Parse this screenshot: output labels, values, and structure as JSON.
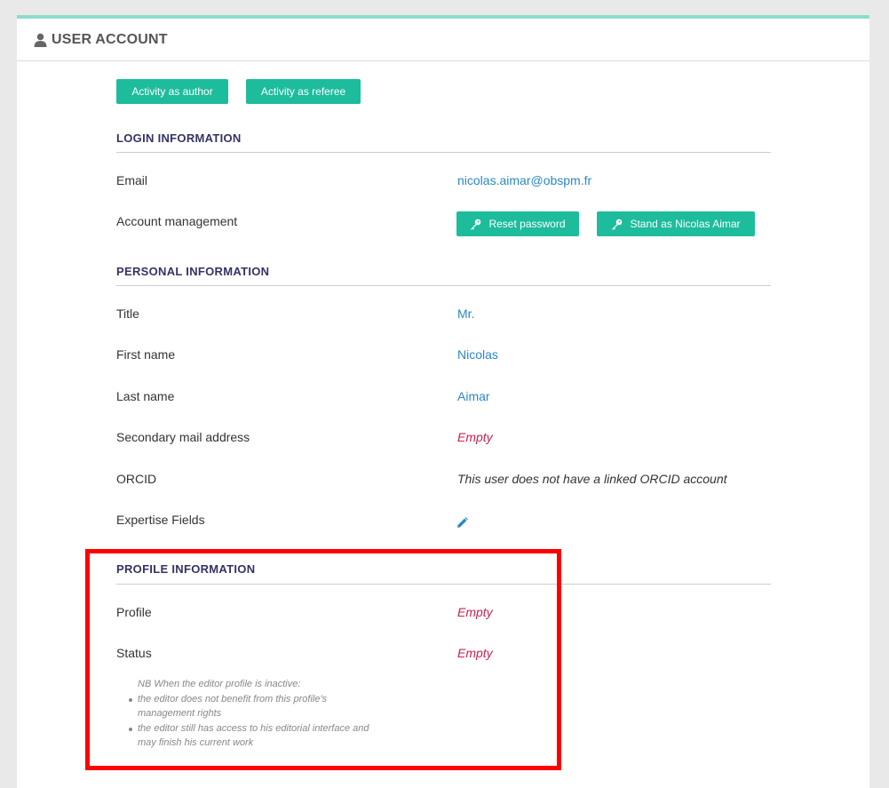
{
  "header": {
    "title": "USER ACCOUNT",
    "icon": "user-icon"
  },
  "actions": {
    "author_label": "Activity as author",
    "referee_label": "Activity as referee"
  },
  "login": {
    "title": "LOGIN INFORMATION",
    "email_label": "Email",
    "email_value": "nicolas.aimar@obspm.fr",
    "account_label": "Account management",
    "reset_label": "Reset password",
    "stand_label": "Stand as Nicolas Aimar"
  },
  "personal": {
    "title": "PERSONAL INFORMATION",
    "title_label": "Title",
    "title_value": "Mr.",
    "first_label": "First name",
    "first_value": "Nicolas",
    "last_label": "Last name",
    "last_value": "Aimar",
    "secondary_label": "Secondary mail address",
    "secondary_value": "Empty",
    "orcid_label": "ORCID",
    "orcid_value": "This user does not have a linked ORCID account",
    "expertise_label": "Expertise Fields",
    "expertise_icon": "pencil-icon"
  },
  "profile": {
    "title": "PROFILE INFORMATION",
    "profile_label": "Profile",
    "profile_value": "Empty",
    "status_label": "Status",
    "status_value": "Empty",
    "nb_head": "NB When the editor profile is inactive:",
    "nb_items": [
      "the editor does not benefit from this profile's management rights",
      "the editor still has access to his editorial interface and may finish his current work"
    ]
  },
  "colors": {
    "accent": "#1dbc9c",
    "link": "#2a87c8",
    "empty": "#cc1f4a",
    "section_title": "#333366",
    "highlight": "#ff0000"
  }
}
